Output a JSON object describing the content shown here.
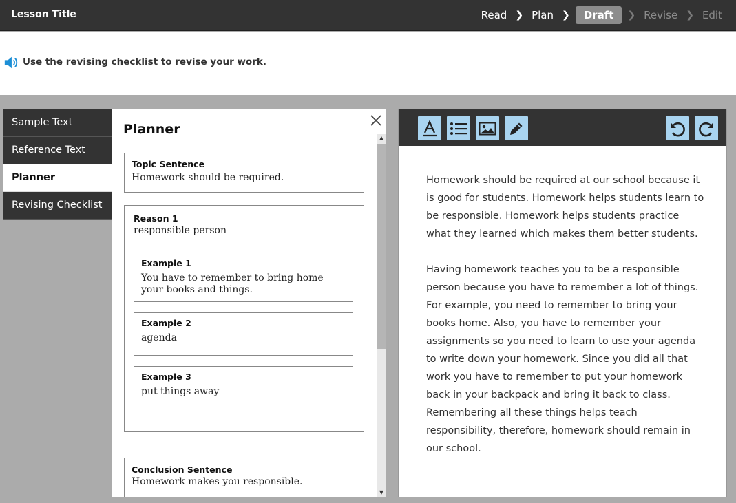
{
  "header": {
    "lesson_title": "Lesson Title",
    "steps": [
      {
        "label": "Read",
        "state": "done"
      },
      {
        "label": "Plan",
        "state": "done"
      },
      {
        "label": "Draft",
        "state": "current"
      },
      {
        "label": "Revise",
        "state": "future"
      },
      {
        "label": "Edit",
        "state": "future"
      }
    ]
  },
  "instruction": {
    "icon": "speaker-icon",
    "text": "Use the revising checklist to revise your work."
  },
  "tabs": [
    {
      "label": "Sample Text",
      "active": false
    },
    {
      "label": "Reference Text",
      "active": false
    },
    {
      "label": "Planner",
      "active": true
    },
    {
      "label": "Revising Checklist",
      "active": false
    }
  ],
  "planner": {
    "title": "Planner",
    "topic": {
      "label": "Topic Sentence",
      "value": "Homework should be required."
    },
    "reason": {
      "label": "Reason 1",
      "value": "responsible person",
      "examples": [
        {
          "label": "Example 1",
          "value": "You have to remember to bring home your books and things."
        },
        {
          "label": "Example 2",
          "value": "agenda"
        },
        {
          "label": "Example 3",
          "value": "put things away"
        }
      ]
    },
    "conclusion": {
      "label": "Conclusion Sentence",
      "value": "Homework makes you responsible."
    }
  },
  "editor": {
    "toolbar": [
      "text-format-icon",
      "bullet-list-icon",
      "image-icon",
      "pencil-icon",
      "undo-icon",
      "redo-icon"
    ],
    "accent_color": "#a9d4f0",
    "paragraphs": [
      "Homework should be required at our school because it is good for students. Homework helps students learn to be responsible. Homework helps students practice what they learned which makes them better students.",
      "Having homework teaches you to be a responsible person because you have to remember a lot of things. For example, you need to remember to bring your books home. Also, you have to remember your assignments so you need to learn to use your agenda to write down your homework. Since you did all that work you have to remember to put your homework back in your backpack and bring it back to class. Remembering all these things helps teach responsibility, therefore, homework should remain in our school."
    ]
  }
}
